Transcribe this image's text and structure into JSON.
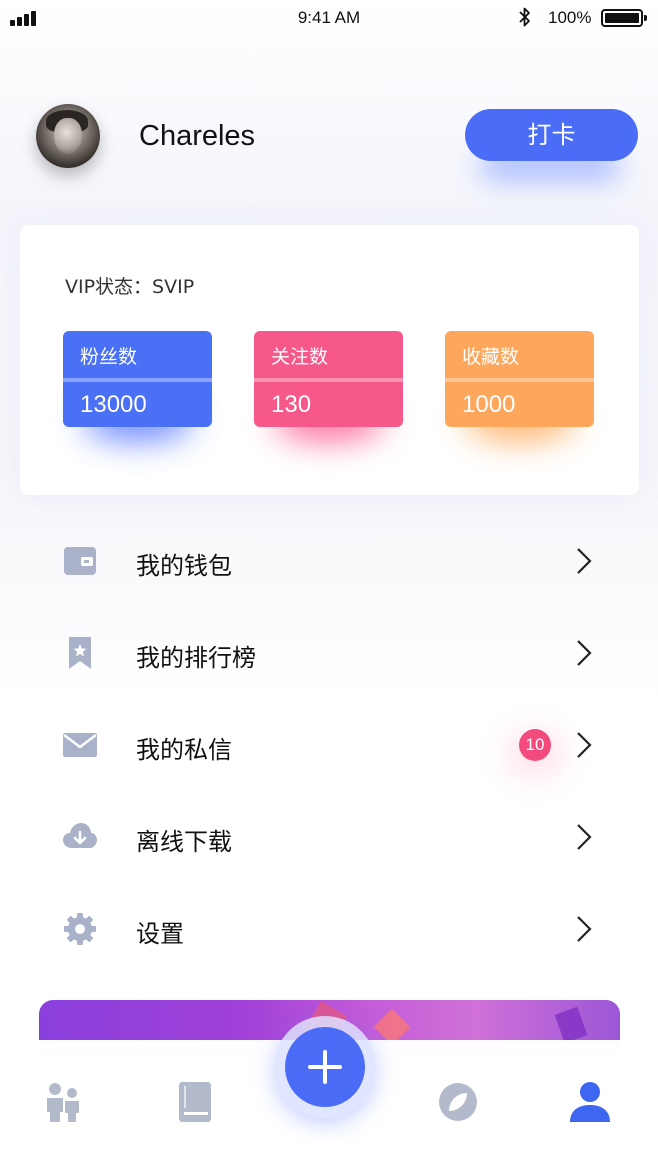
{
  "status_bar": {
    "time": "9:41 AM",
    "battery_percent": "100%",
    "icons": [
      "signal-icon",
      "bluetooth-icon",
      "battery-icon"
    ]
  },
  "profile": {
    "username": "Chareles",
    "checkin_label": "打卡"
  },
  "vip_card": {
    "status_text": "VIP状态：SVIP",
    "stats": [
      {
        "label": "粉丝数",
        "value": "13000",
        "color": "#4a71f5"
      },
      {
        "label": "关注数",
        "value": "130",
        "color": "#f7588a"
      },
      {
        "label": "收藏数",
        "value": "1000",
        "color": "#fca75c"
      }
    ]
  },
  "menu": {
    "items": [
      {
        "label": "我的钱包",
        "icon": "wallet-icon"
      },
      {
        "label": "我的排行榜",
        "icon": "bookmark-star-icon"
      },
      {
        "label": "我的私信",
        "icon": "mail-icon",
        "badge": "10"
      },
      {
        "label": "离线下载",
        "icon": "cloud-download-icon"
      },
      {
        "label": "设置",
        "icon": "gear-icon"
      }
    ]
  },
  "tab_bar": {
    "tabs": [
      {
        "icon": "people-icon",
        "active": false
      },
      {
        "icon": "book-icon",
        "active": false
      },
      {
        "icon": "plus-icon",
        "active": false
      },
      {
        "icon": "compass-icon",
        "active": false
      },
      {
        "icon": "user-icon",
        "active": true
      }
    ],
    "active_color": "#3d67f0",
    "inactive_color": "#b3bacb"
  },
  "colors": {
    "accent": "#4a6cf7",
    "icon_gray": "#a9b2c9",
    "badge": "#f44b7f"
  }
}
